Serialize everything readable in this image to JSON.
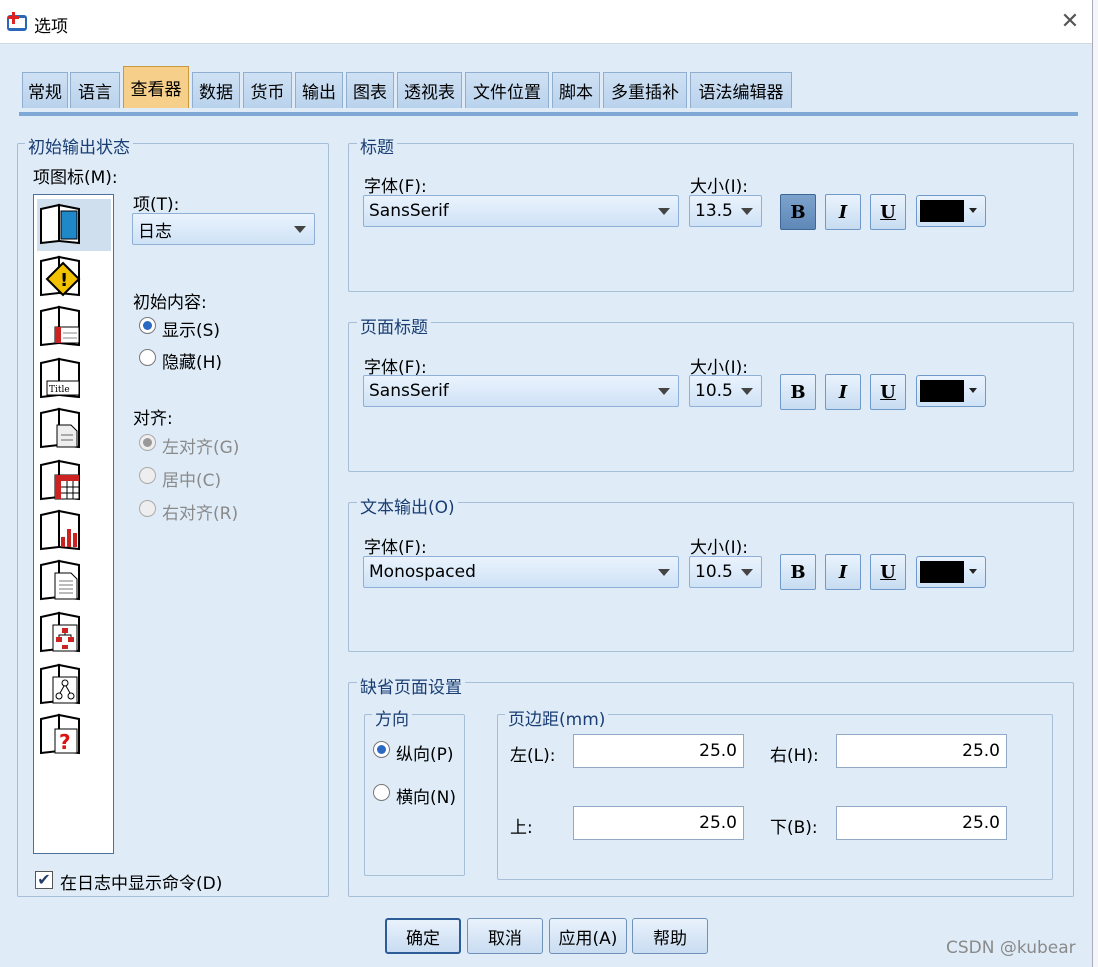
{
  "window": {
    "title": "选项",
    "close_icon": "close-icon"
  },
  "tabs": [
    {
      "label": "常规"
    },
    {
      "label": "语言"
    },
    {
      "label": "查看器",
      "active": true
    },
    {
      "label": "数据"
    },
    {
      "label": "货币"
    },
    {
      "label": "输出"
    },
    {
      "label": "图表"
    },
    {
      "label": "透视表"
    },
    {
      "label": "文件位置"
    },
    {
      "label": "脚本"
    },
    {
      "label": "多重插补"
    },
    {
      "label": "语法编辑器"
    }
  ],
  "initial_output": {
    "legend": "初始输出状态",
    "item_icons_label": "项图标(M):",
    "item_label": "项(T):",
    "item_value": "日志",
    "icons": [
      "log-icon",
      "warning-icon",
      "notes-icon",
      "title-icon",
      "page-title-icon",
      "pivot-table-icon",
      "chart-icon",
      "text-output-icon",
      "tree-model-icon",
      "model-viewer-icon",
      "unknown-object-icon"
    ],
    "initial_content_label": "初始内容:",
    "show_label": "显示(S)",
    "hide_label": "隐藏(H)",
    "content_selected": "show",
    "align_label": "对齐:",
    "align_left": "左对齐(G)",
    "align_center": "居中(C)",
    "align_right": "右对齐(R)",
    "show_commands_label": "在日志中显示命令(D)",
    "show_commands_checked": true
  },
  "title_group": {
    "legend": "标题",
    "font_label": "字体(F):",
    "font_value": "SansSerif",
    "size_label": "大小(I):",
    "size_value": "13.5",
    "bold": true,
    "color": "#000000"
  },
  "page_title_group": {
    "legend": "页面标题",
    "font_label": "字体(F):",
    "font_value": "SansSerif",
    "size_label": "大小(I):",
    "size_value": "10.5",
    "bold": false,
    "color": "#000000"
  },
  "text_output_group": {
    "legend": "文本输出(O)",
    "font_label": "字体(F):",
    "font_value": "Monospaced",
    "size_label": "大小(I):",
    "size_value": "10.5",
    "bold": false,
    "color": "#000000"
  },
  "format_buttons": {
    "bold": "B",
    "italic": "I",
    "underline": "U"
  },
  "page_setup": {
    "legend": "缺省页面设置",
    "orientation_legend": "方向",
    "portrait_label": "纵向(P)",
    "landscape_label": "横向(N)",
    "orientation_selected": "portrait",
    "margins_legend": "页边距(mm)",
    "left_label": "左(L):",
    "left_value": "25.0",
    "right_label": "右(H):",
    "right_value": "25.0",
    "top_label": "上:",
    "top_value": "25.0",
    "bottom_label": "下(B):",
    "bottom_value": "25.0"
  },
  "buttons": {
    "ok": "确定",
    "cancel": "取消",
    "apply": "应用(A)",
    "help": "帮助"
  },
  "watermark": "CSDN @kubear"
}
